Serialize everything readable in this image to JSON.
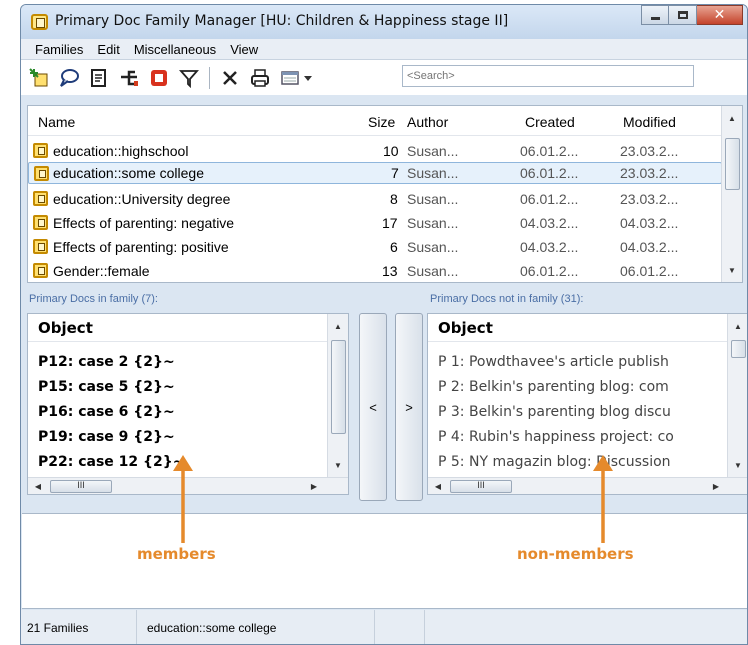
{
  "window": {
    "title": "Primary Doc Family Manager [HU: Children & Happiness stage II]"
  },
  "menu": [
    "Families",
    "Edit",
    "Miscellaneous",
    "View"
  ],
  "toolbar": {
    "icons": [
      "new-family-icon",
      "comment-icon",
      "document-icon",
      "network-icon",
      "stop-icon",
      "filter-icon",
      "delete-icon",
      "print-icon",
      "view-options-icon",
      "dropdown-arrow-icon"
    ],
    "search_placeholder": "<Search>"
  },
  "families_table": {
    "columns": [
      "Name",
      "Size",
      "Author",
      "Created",
      "Modified"
    ],
    "rows": [
      {
        "name": "education::highschool",
        "size": "10",
        "author": "Susan...",
        "created": "06.01.2...",
        "modified": "23.03.2..."
      },
      {
        "name": "education::some college",
        "size": "7",
        "author": "Susan...",
        "created": "06.01.2...",
        "modified": "23.03.2...",
        "selected": true
      },
      {
        "name": "education::University degree",
        "size": "8",
        "author": "Susan...",
        "created": "06.01.2...",
        "modified": "23.03.2..."
      },
      {
        "name": "Effects of parenting: negative",
        "size": "17",
        "author": "Susan...",
        "created": "04.03.2...",
        "modified": "04.03.2..."
      },
      {
        "name": "Effects of parenting: positive",
        "size": "6",
        "author": "Susan...",
        "created": "04.03.2...",
        "modified": "04.03.2..."
      },
      {
        "name": "Gender::female",
        "size": "13",
        "author": "Susan...",
        "created": "06.01.2...",
        "modified": "06.01.2..."
      }
    ]
  },
  "members": {
    "label": "Primary Docs in family (7):",
    "column": "Object",
    "items": [
      "P12: case 2 {2}~",
      "P15: case 5 {2}~",
      "P16: case 6 {2}~",
      "P19: case 9 {2}~",
      "P22: case 12 {2}~"
    ]
  },
  "non_members": {
    "label": "Primary Docs not in family (31):",
    "column": "Object",
    "items": [
      "P 1: Powdthavee's article publish",
      "P 2: Belkin's parenting blog: com",
      "P 3: Belkin's parenting blog discu",
      "P 4: Rubin's happiness project: co",
      "P 5: NY magazin blog: Discussion"
    ]
  },
  "move_buttons": {
    "add": "<",
    "remove": ">"
  },
  "annotations": {
    "members": "members",
    "non_members": "non-members",
    "color": "#e58a2c"
  },
  "status": {
    "families": "21 Families",
    "selected": "education::some college"
  }
}
